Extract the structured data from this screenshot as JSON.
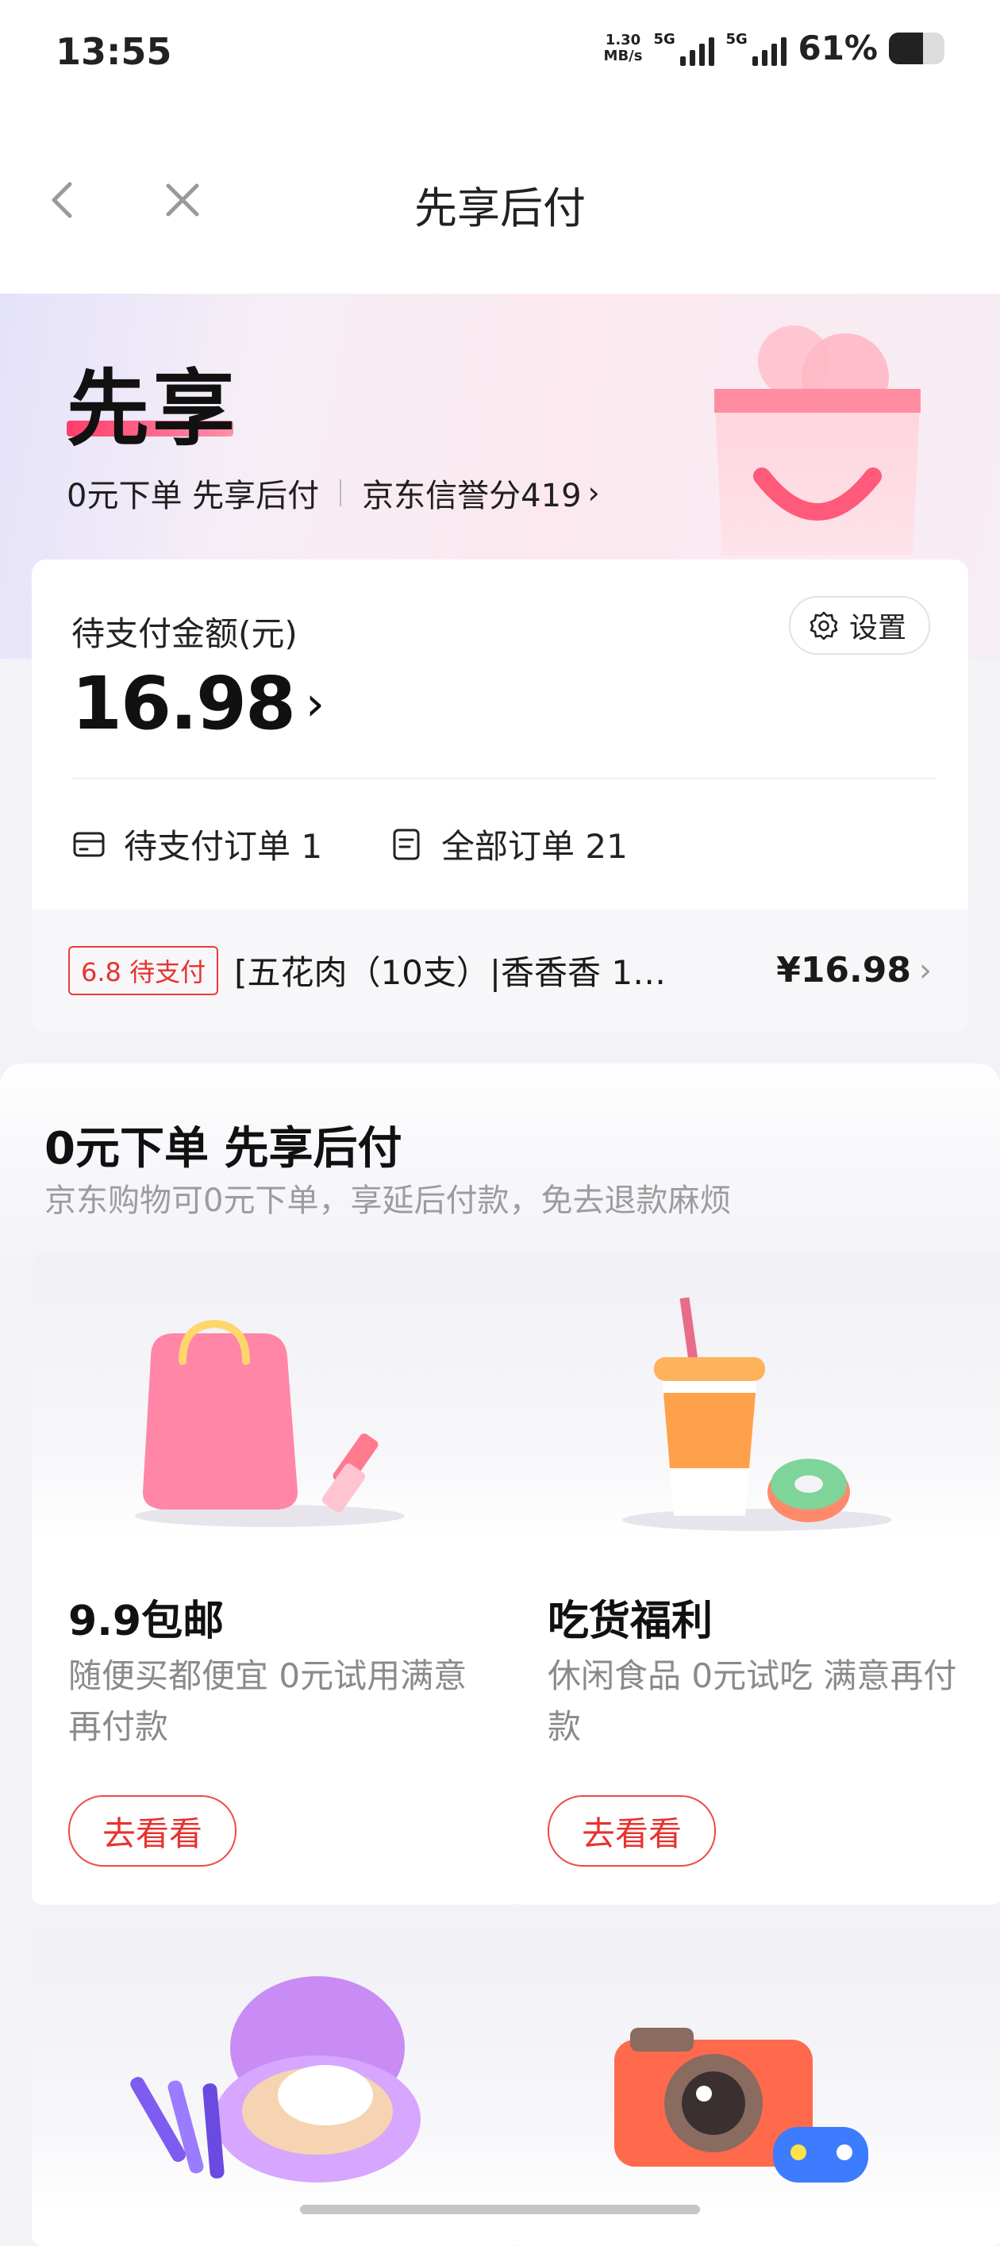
{
  "status_bar": {
    "time": "13:55",
    "net_speed_value": "1.30",
    "net_speed_unit": "MB/s",
    "sim1_label": "5G",
    "sim2_label": "5G",
    "battery_percent_text": "61%",
    "battery_level": 0.61
  },
  "nav": {
    "title": "先享后付",
    "back_icon": "chevron-left-icon",
    "close_icon": "close-icon"
  },
  "hero": {
    "title": "先享",
    "subtitle_left": "0元下单 先享后付",
    "credit_text": "京东信誉分419",
    "chevron": "›"
  },
  "payment": {
    "label": "待支付金额(元)",
    "amount": "16.98",
    "chevron": "›",
    "settings_label": "设置",
    "pending_orders_label": "待支付订单 1",
    "all_orders_label": "全部订单 21",
    "order": {
      "badge": "6.8 待支付",
      "name": "[五花肉（10支）|香香香 1…",
      "price": "¥16.98",
      "chevron": "›"
    }
  },
  "promo": {
    "title": "0元下单 先享后付",
    "subtitle": "京东购物可0元下单，享延后付款，免去退款麻烦",
    "tiles": [
      {
        "title": "9.9包邮",
        "desc": "随便买都便宜 0元试用满意再付款",
        "button": "去看看",
        "icon": "shopping-bag-icon"
      },
      {
        "title": "吃货福利",
        "desc": "休闲食品 0元试吃 满意再付款",
        "button": "去看看",
        "icon": "coffee-donut-icon"
      },
      {
        "icon": "makeup-compact-icon"
      },
      {
        "icon": "camera-gamepad-icon"
      }
    ]
  },
  "colors": {
    "accent_red": "#e8322f",
    "hero_pink": "#fbe9ef"
  }
}
